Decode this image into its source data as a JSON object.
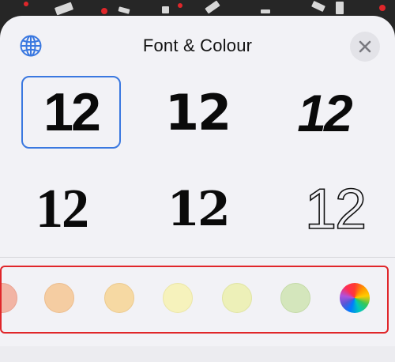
{
  "sheet": {
    "title": "Font & Colour",
    "globe_icon": "globe-icon",
    "close_icon": "close-icon"
  },
  "fonts": [
    {
      "label": "12",
      "style": "rounded-sans",
      "selected": true
    },
    {
      "label": "12",
      "style": "geometric-sans",
      "selected": false
    },
    {
      "label": "12",
      "style": "stencil-sans",
      "selected": false
    },
    {
      "label": "12",
      "style": "serif",
      "selected": false
    },
    {
      "label": "12",
      "style": "slab-serif",
      "selected": false
    },
    {
      "label": "12",
      "style": "outline",
      "selected": false
    }
  ],
  "colours": [
    {
      "name": "red",
      "hex": "#f2b4a4"
    },
    {
      "name": "orange",
      "hex": "#f5cda2"
    },
    {
      "name": "amber",
      "hex": "#f6d9a3"
    },
    {
      "name": "yellow",
      "hex": "#f6f2bc"
    },
    {
      "name": "lime",
      "hex": "#edf0b8"
    },
    {
      "name": "green",
      "hex": "#d4e6bc"
    },
    {
      "name": "custom",
      "hex": "multicolor"
    }
  ],
  "accent": "#3a78e0",
  "highlight_border": "#e0262a"
}
